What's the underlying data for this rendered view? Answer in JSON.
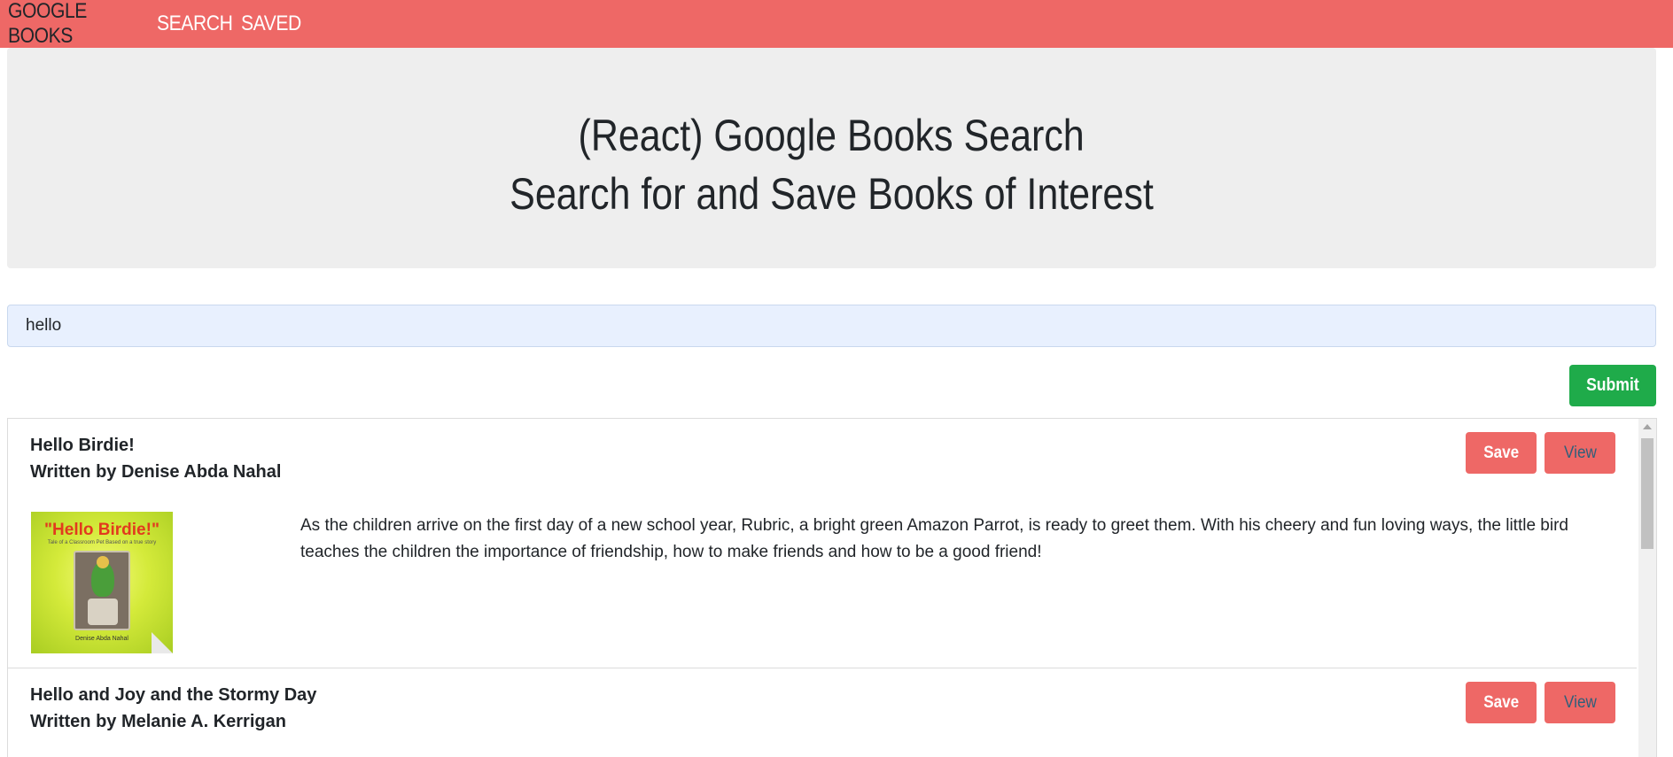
{
  "nav": {
    "brand": "GOOGLE BOOKS",
    "links": [
      "SEARCH",
      "SAVED"
    ]
  },
  "jumbotron": {
    "title": "(React) Google Books Search",
    "subtitle": "Search for and Save Books of Interest"
  },
  "search": {
    "value": "hello",
    "submit_label": "Submit"
  },
  "books": [
    {
      "title": "Hello Birdie!",
      "author": "Written by Denise Abda Nahal",
      "description": "As the children arrive on the first day of a new school year, Rubric, a bright green Amazon Parrot, is ready to greet them. With his cheery and fun loving ways, the little bird teaches the children the importance of friendship, how to make friends and how to be a good friend!",
      "save_label": "Save",
      "view_label": "View",
      "thumbnail": {
        "cover_title": "\"Hello Birdie!\"",
        "cover_subtitle": "Tale of a Classroom Pet Based on a true story",
        "cover_author": "Denise Abda Nahal"
      }
    },
    {
      "title": "Hello and Joy and the Stormy Day",
      "author": "Written by Melanie A. Kerrigan",
      "save_label": "Save",
      "view_label": "View"
    }
  ],
  "colors": {
    "navbar": "#ee6866",
    "jumbotron": "#eeeeee",
    "submit": "#1fab4a",
    "button": "#ee6866"
  }
}
